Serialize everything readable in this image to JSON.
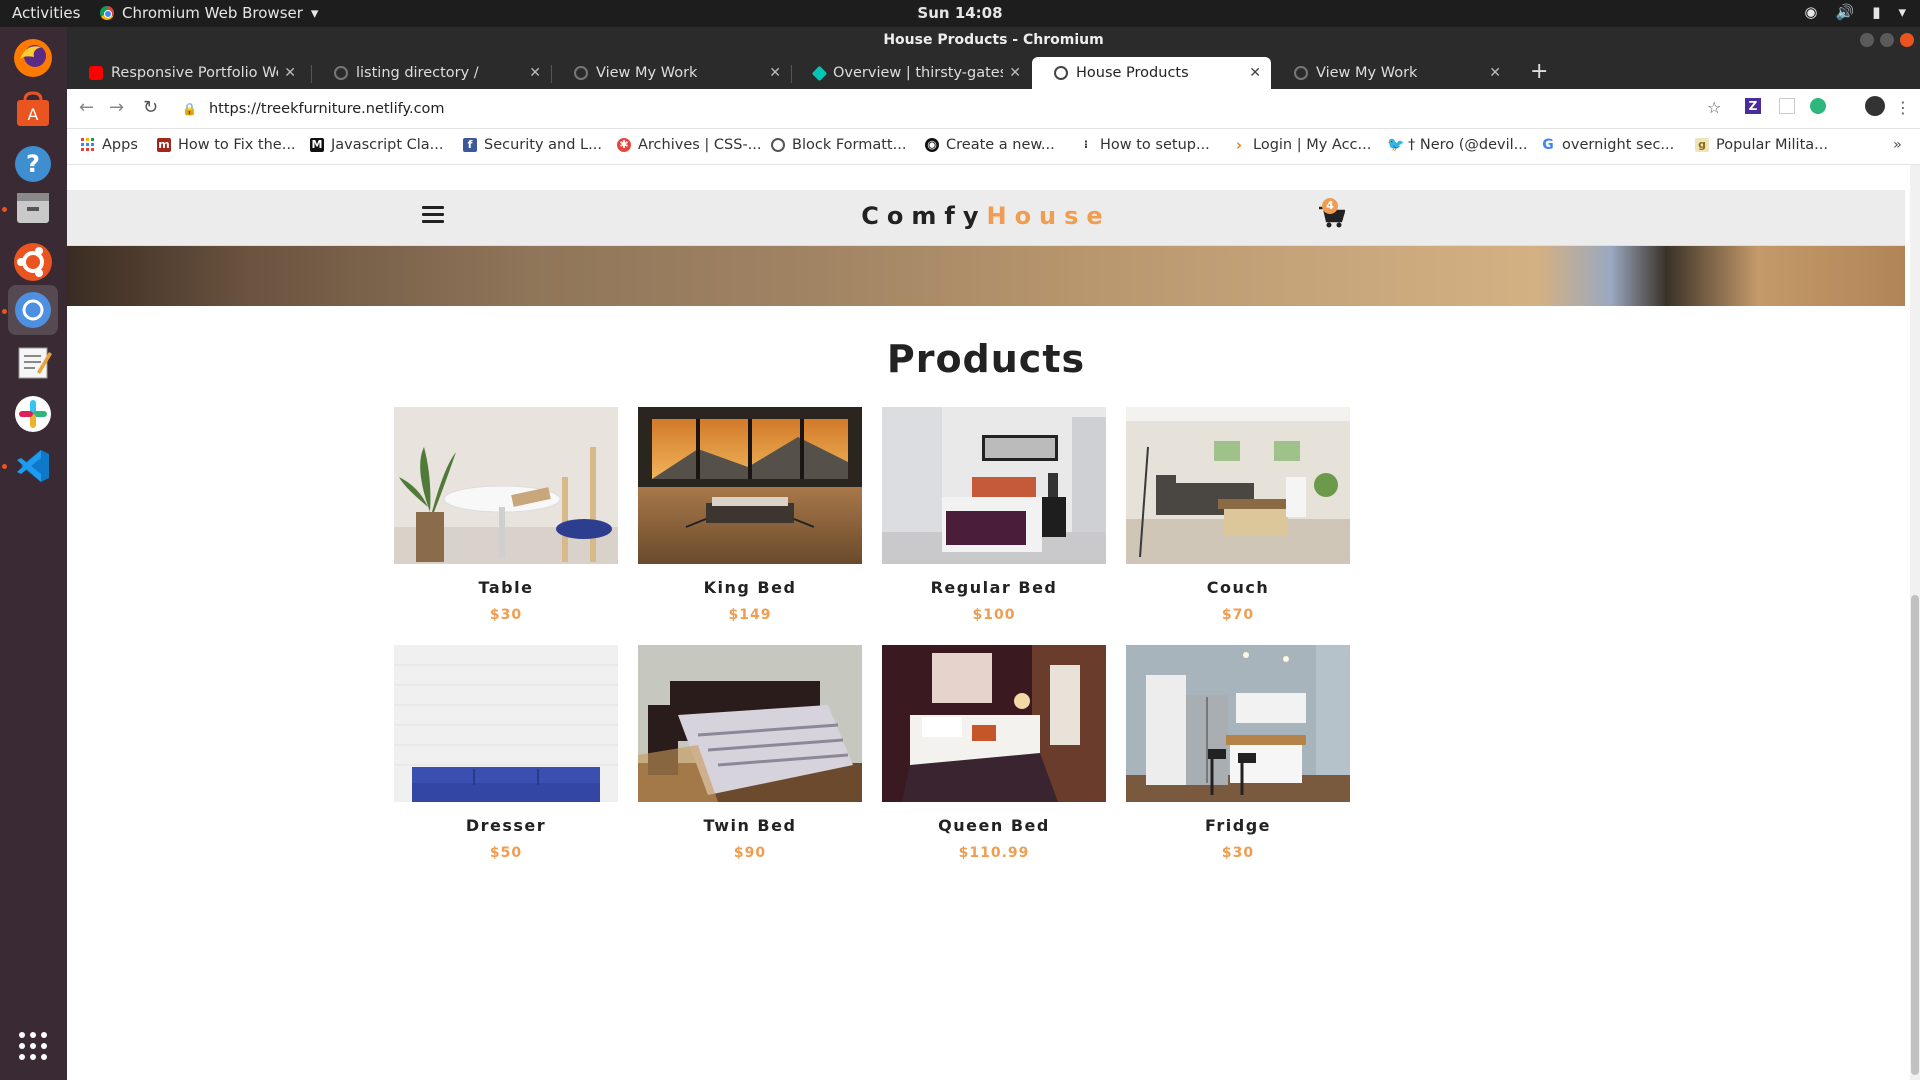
{
  "system": {
    "activities": "Activities",
    "app_name": "Chromium Web Browser",
    "clock": "Sun 14:08"
  },
  "window": {
    "title": "House Products - Chromium"
  },
  "tabs": [
    {
      "label": "Responsive Portfolio Wel",
      "favicon_color": "#ff0000"
    },
    {
      "label": "listing directory /",
      "favicon_color": "#777777"
    },
    {
      "label": "View My Work",
      "favicon_color": "#777777"
    },
    {
      "label": "Overview | thirsty-gates-c",
      "favicon_color": "#00c7b7"
    },
    {
      "label": "House Products",
      "favicon_color": "#444444",
      "active": true
    },
    {
      "label": "View My Work",
      "favicon_color": "#777777"
    }
  ],
  "address": {
    "url": "https://treekfurniture.netlify.com"
  },
  "bookmarks": [
    {
      "label": "Apps",
      "icon": "apps-grid-icon",
      "color": "#4285f4"
    },
    {
      "label": "How to Fix the...",
      "icon": "m-icon",
      "color": "#a0271c"
    },
    {
      "label": "Javascript Cla...",
      "icon": "medium-icon",
      "color": "#111111"
    },
    {
      "label": "Security and L...",
      "icon": "facebook-icon",
      "color": "#3b5998"
    },
    {
      "label": "Archives | CSS-...",
      "icon": "css-tricks-icon",
      "color": "#e8453c"
    },
    {
      "label": "Block Formatt...",
      "icon": "globe-icon",
      "color": "#555555"
    },
    {
      "label": "Create a new...",
      "icon": "github-icon",
      "color": "#111111"
    },
    {
      "label": "How to setup...",
      "icon": "dots-icon",
      "color": "#333333"
    },
    {
      "label": "Login | My Acc...",
      "icon": "chevron-icon",
      "color": "#f47c20"
    },
    {
      "label": "† Nero (@devil...",
      "icon": "twitter-icon",
      "color": "#1da1f2"
    },
    {
      "label": "overnight sec...",
      "icon": "google-icon",
      "color": "#4285f4"
    },
    {
      "label": "Popular Milita...",
      "icon": "g-icon",
      "color": "#c8a23a"
    }
  ],
  "site": {
    "brand_part1": "Comfy",
    "brand_part2": "House",
    "cart_count": "4",
    "accent_color": "#f09d51",
    "section_title": "Products"
  },
  "products": [
    {
      "name": "Table",
      "price": "$30"
    },
    {
      "name": "King Bed",
      "price": "$149"
    },
    {
      "name": "Regular Bed",
      "price": "$100"
    },
    {
      "name": "Couch",
      "price": "$70"
    },
    {
      "name": "Dresser",
      "price": "$50"
    },
    {
      "name": "Twin Bed",
      "price": "$90"
    },
    {
      "name": "Queen Bed",
      "price": "$110.99"
    },
    {
      "name": "Fridge",
      "price": "$30"
    }
  ]
}
